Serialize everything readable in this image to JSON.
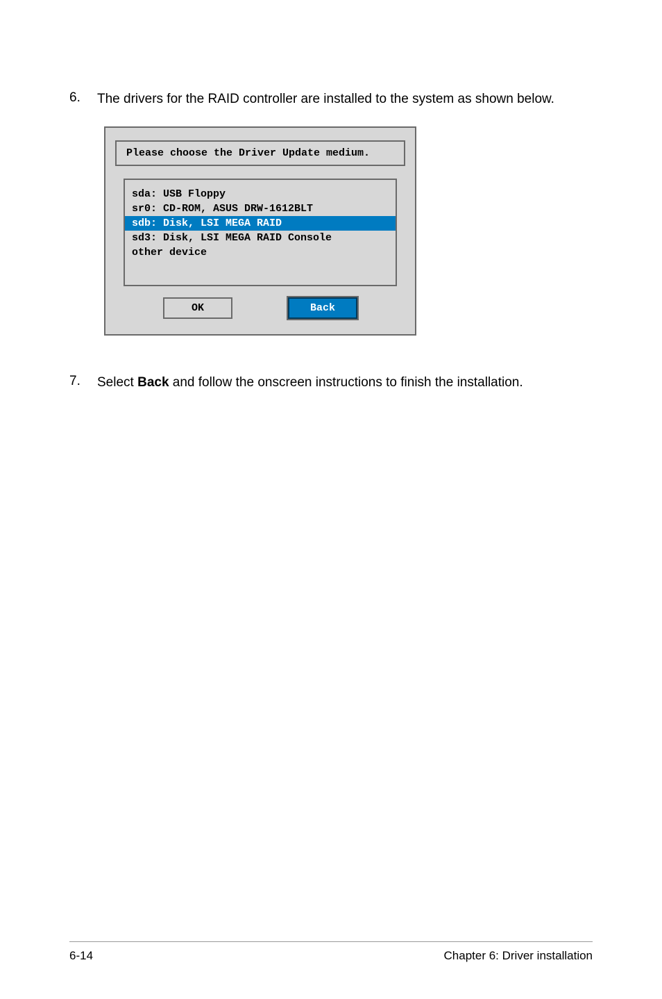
{
  "steps": [
    {
      "num": "6.",
      "text": "The drivers for the RAID controller are installed to the system as shown below."
    },
    {
      "num": "7.",
      "text_before": "Select ",
      "bold": "Back",
      "text_after": " and follow the onscreen instructions to finish the installation."
    }
  ],
  "dialog": {
    "title": "Please choose the Driver Update medium.",
    "items": [
      "sda: USB Floppy",
      "sr0: CD-ROM, ASUS DRW-1612BLT",
      "sdb: Disk, LSI MEGA RAID",
      "sd3: Disk, LSI MEGA RAID Console",
      "other device"
    ],
    "selected_index": 2,
    "buttons": {
      "ok": "OK",
      "back": "Back"
    }
  },
  "footer": {
    "left": "6-14",
    "right": "Chapter 6: Driver installation"
  }
}
